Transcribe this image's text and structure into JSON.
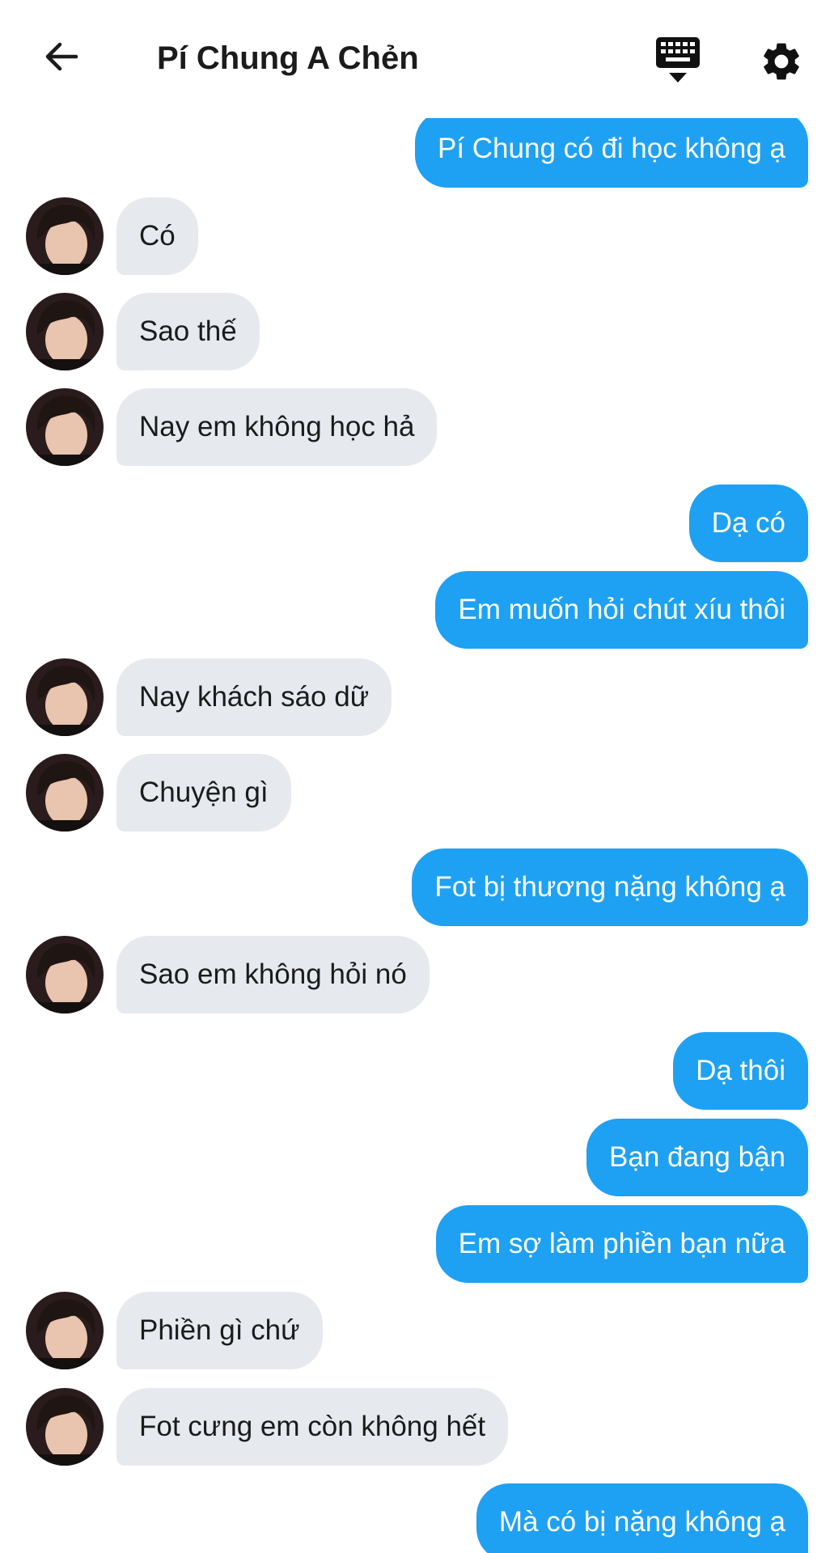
{
  "header": {
    "title": "Pí Chung A Chẻn",
    "back_icon": "arrow-left-icon",
    "keyboard_icon": "keyboard-icon",
    "settings_icon": "gear-icon"
  },
  "colors": {
    "sent_bubble": "#1ea1f2",
    "received_bubble": "#e6eaef",
    "text_dark": "#1b1b1b"
  },
  "messages": [
    {
      "side": "sent",
      "text": "Pí Chung có đi học không ạ"
    },
    {
      "side": "received",
      "text": "Có"
    },
    {
      "side": "received",
      "text": "Sao thế"
    },
    {
      "side": "received",
      "text": "Nay em không học hả"
    },
    {
      "side": "sent",
      "text": "Dạ có"
    },
    {
      "side": "sent",
      "text": "Em muốn hỏi chút xíu thôi"
    },
    {
      "side": "received",
      "text": "Nay khách sáo dữ"
    },
    {
      "side": "received",
      "text": "Chuyện gì"
    },
    {
      "side": "sent",
      "text": "Fot bị thương nặng không ạ"
    },
    {
      "side": "received",
      "text": "Sao em không hỏi nó"
    },
    {
      "side": "sent",
      "text": "Dạ thôi"
    },
    {
      "side": "sent",
      "text": "Bạn đang bận"
    },
    {
      "side": "sent",
      "text": "Em sợ làm phiền bạn nữa"
    },
    {
      "side": "received",
      "text": "Phiền gì chứ"
    },
    {
      "side": "received",
      "text": "Fot cưng em còn không hết"
    },
    {
      "side": "sent",
      "text": "Mà có bị nặng không ạ"
    }
  ]
}
